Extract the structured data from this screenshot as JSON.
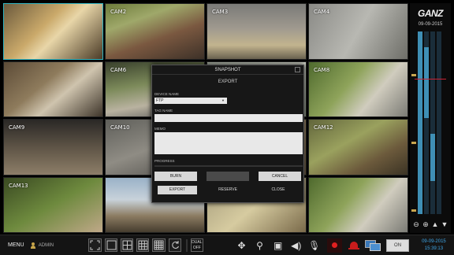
{
  "brand": {
    "logo": "GANZ"
  },
  "timeline": {
    "date": "09-09-2015",
    "controls": [
      "zoom-out-icon",
      "zoom-in-icon",
      "up-arrow-icon",
      "down-arrow-icon"
    ]
  },
  "cameras": [
    {
      "label": "",
      "scene": "scene-a",
      "selected": true
    },
    {
      "label": "CAM2",
      "scene": "scene-b"
    },
    {
      "label": "CAM3",
      "scene": "scene-c"
    },
    {
      "label": "CAM4",
      "scene": "scene-d"
    },
    {
      "label": "",
      "scene": "scene-e"
    },
    {
      "label": "CAM6",
      "scene": "scene-f"
    },
    {
      "label": "",
      "scene": "scene-g"
    },
    {
      "label": "CAM8",
      "scene": "scene-h"
    },
    {
      "label": "CAM9",
      "scene": "scene-i"
    },
    {
      "label": "CAM10",
      "scene": "scene-j"
    },
    {
      "label": "",
      "scene": "scene-k"
    },
    {
      "label": "CAM12",
      "scene": "scene-l"
    },
    {
      "label": "CAM13",
      "scene": "scene-n"
    },
    {
      "label": "",
      "scene": "scene-m"
    },
    {
      "label": "",
      "scene": "scene-o"
    },
    {
      "label": "",
      "scene": "scene-h"
    }
  ],
  "bottom_bar": {
    "menu_label": "MENU",
    "user": "ADMIN",
    "dual_label_top": "DUAL",
    "dual_label_bottom": "OFF",
    "on_label": "ON",
    "date": "09-09-2015",
    "time": "15:39:13"
  },
  "snapshot_dialog": {
    "title": "SNAPSHOT",
    "subtitle": "EXPORT",
    "device_name_label": "DEVICE NAME",
    "device_name_value": "FTP",
    "tag_name_label": "TAG NAME",
    "memo_label": "MEMO",
    "progress_label": "PROGRESS",
    "burn_label": "BURN",
    "middle_button_label": "",
    "cancel_label": "CANCEL",
    "tabs": [
      "EXPORT",
      "RESERVE",
      "CLOSE"
    ]
  },
  "colors": {
    "accent": "#3fa7e8",
    "record": "#e02020",
    "selected_border": "#2fb3c0"
  }
}
